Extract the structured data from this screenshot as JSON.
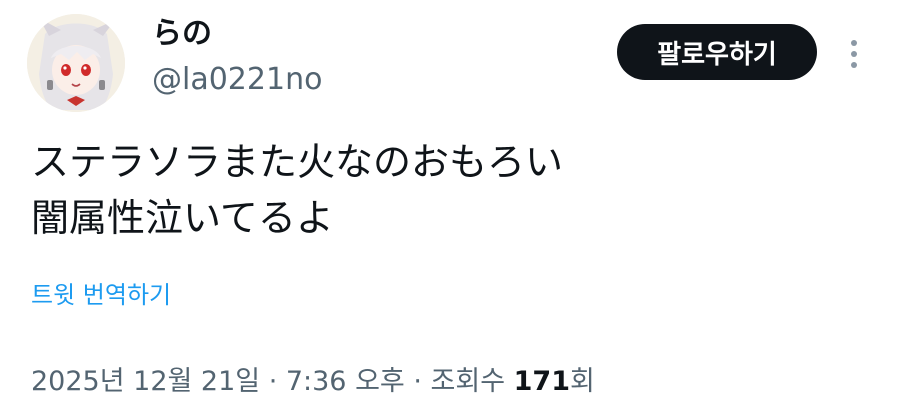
{
  "author": {
    "display_name": "らの",
    "handle": "@la0221no",
    "avatar_icon": "anime-character-avatar"
  },
  "actions": {
    "follow_label": "팔로우하기",
    "more_icon": "more-vertical-icon"
  },
  "tweet": {
    "text": "ステラソラまた火なのおもろい\n闇属性泣いてるよ",
    "translate_label": "트윗 번역하기"
  },
  "meta": {
    "timestamp": "2025년 12월 21일 · 7:36 오후",
    "separator": " · ",
    "views_label": "조회수",
    "views_count": "171",
    "views_suffix": "회"
  },
  "colors": {
    "text_primary": "#0f1419",
    "text_secondary": "#536471",
    "link": "#1d9bf0",
    "button_bg": "#0f1419"
  }
}
